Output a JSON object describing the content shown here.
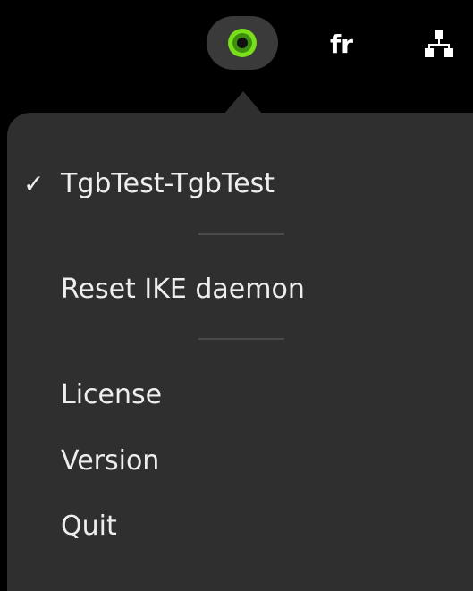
{
  "topbar": {
    "vpn_icon": "vpn-status-icon",
    "language": "fr",
    "network_icon": "wired-network-icon"
  },
  "menu": {
    "connection": {
      "checkmark": "✓",
      "label": "TgbTest-TgbTest",
      "checked": true
    },
    "reset_label": "Reset IKE daemon",
    "license_label": "License",
    "version_label": "Version",
    "quit_label": "Quit"
  },
  "colors": {
    "background": "#000000",
    "menu_background": "#2f2f2f",
    "indicator_pill": "#3a3a3a",
    "vpn_green": "#7adf1a",
    "text": "#eeeeee"
  }
}
